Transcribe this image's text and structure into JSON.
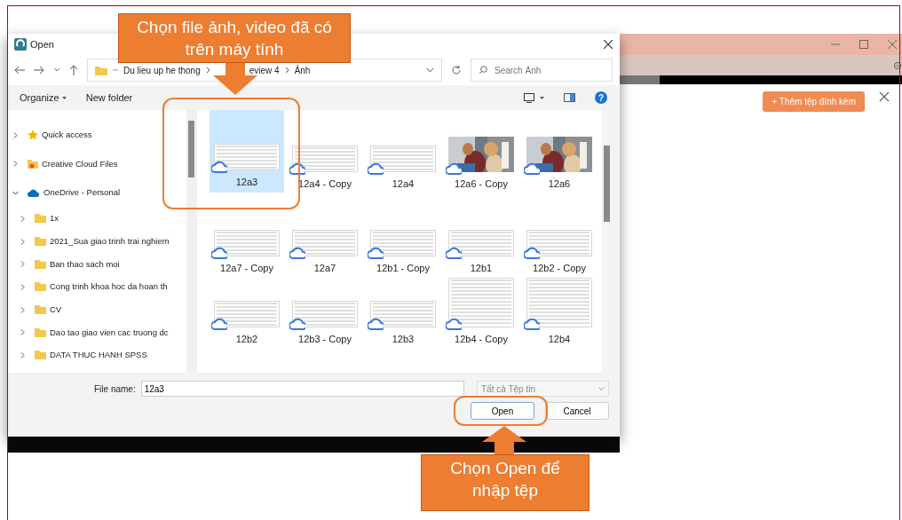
{
  "background_app": {
    "attach_button": {
      "icon": "+",
      "label": "Thêm tệp đính kèm"
    }
  },
  "dialog": {
    "title": "Open",
    "breadcrumb": [
      "Du lieu up he thong",
      "eview 4",
      "Ảnh"
    ],
    "search": {
      "placeholder": "Search Ảnh"
    },
    "toolbar": {
      "organize": "Organize",
      "new_folder": "New folder",
      "help": "?"
    },
    "sidebar": {
      "items": [
        {
          "label": "Quick access",
          "kind": "star",
          "expanded": false
        },
        {
          "label": "Creative Cloud Files",
          "kind": "creative",
          "expanded": false
        },
        {
          "label": "OneDrive - Personal",
          "kind": "cloud",
          "expanded": true,
          "children": [
            {
              "label": "1x",
              "kind": "folder",
              "expanded": false
            },
            {
              "label": "2021_Sua giao trinh trai nghiem",
              "kind": "folder",
              "expanded": false
            },
            {
              "label": "Ban thao sach moi",
              "kind": "folder",
              "expanded": false
            },
            {
              "label": "Cong trinh khoa hoc da hoan th",
              "kind": "folder",
              "expanded": false
            },
            {
              "label": "CV",
              "kind": "folder",
              "expanded": false
            },
            {
              "label": "Dao tao giao vien cac truong dc",
              "kind": "folder",
              "expanded": false
            },
            {
              "label": "DATA THUC HANH SPSS",
              "kind": "folder",
              "expanded": false
            }
          ]
        }
      ]
    },
    "files": [
      {
        "name": "12a3",
        "kind": "wide",
        "selected": true
      },
      {
        "name": "12a4 - Copy",
        "kind": "wide",
        "selected": false
      },
      {
        "name": "12a4",
        "kind": "wide",
        "selected": false
      },
      {
        "name": "12a6 - Copy",
        "selected": false
      },
      {
        "name": "12a6",
        "selected": false
      },
      {
        "name": "12a7 - Copy",
        "kind": "wide",
        "selected": false
      },
      {
        "name": "12a7",
        "kind": "wide",
        "selected": false
      },
      {
        "name": "12b1 - Copy",
        "kind": "wide",
        "selected": false
      },
      {
        "name": "12b1",
        "kind": "wide",
        "selected": false
      },
      {
        "name": "12b2 - Copy",
        "kind": "wide",
        "selected": false
      },
      {
        "name": "12b2",
        "kind": "wide",
        "selected": false
      },
      {
        "name": "12b3 - Copy",
        "kind": "wide",
        "selected": false
      },
      {
        "name": "12b3",
        "kind": "wide",
        "selected": false
      },
      {
        "name": "12b4 - Copy",
        "kind": "tall",
        "selected": false
      },
      {
        "name": "12b4",
        "kind": "tall",
        "selected": false
      }
    ],
    "file_name": {
      "label": "File name:",
      "value": "12a3"
    },
    "file_type": "Tất cả Tệp tin",
    "buttons": [
      "Open",
      "Cancel"
    ]
  },
  "annotations": [
    {
      "text": "Chọn file ảnh, video đã có trên máy tính",
      "kind": "down"
    },
    {
      "text": "Chọn Open để nhập tệp",
      "kind": "up"
    }
  ]
}
